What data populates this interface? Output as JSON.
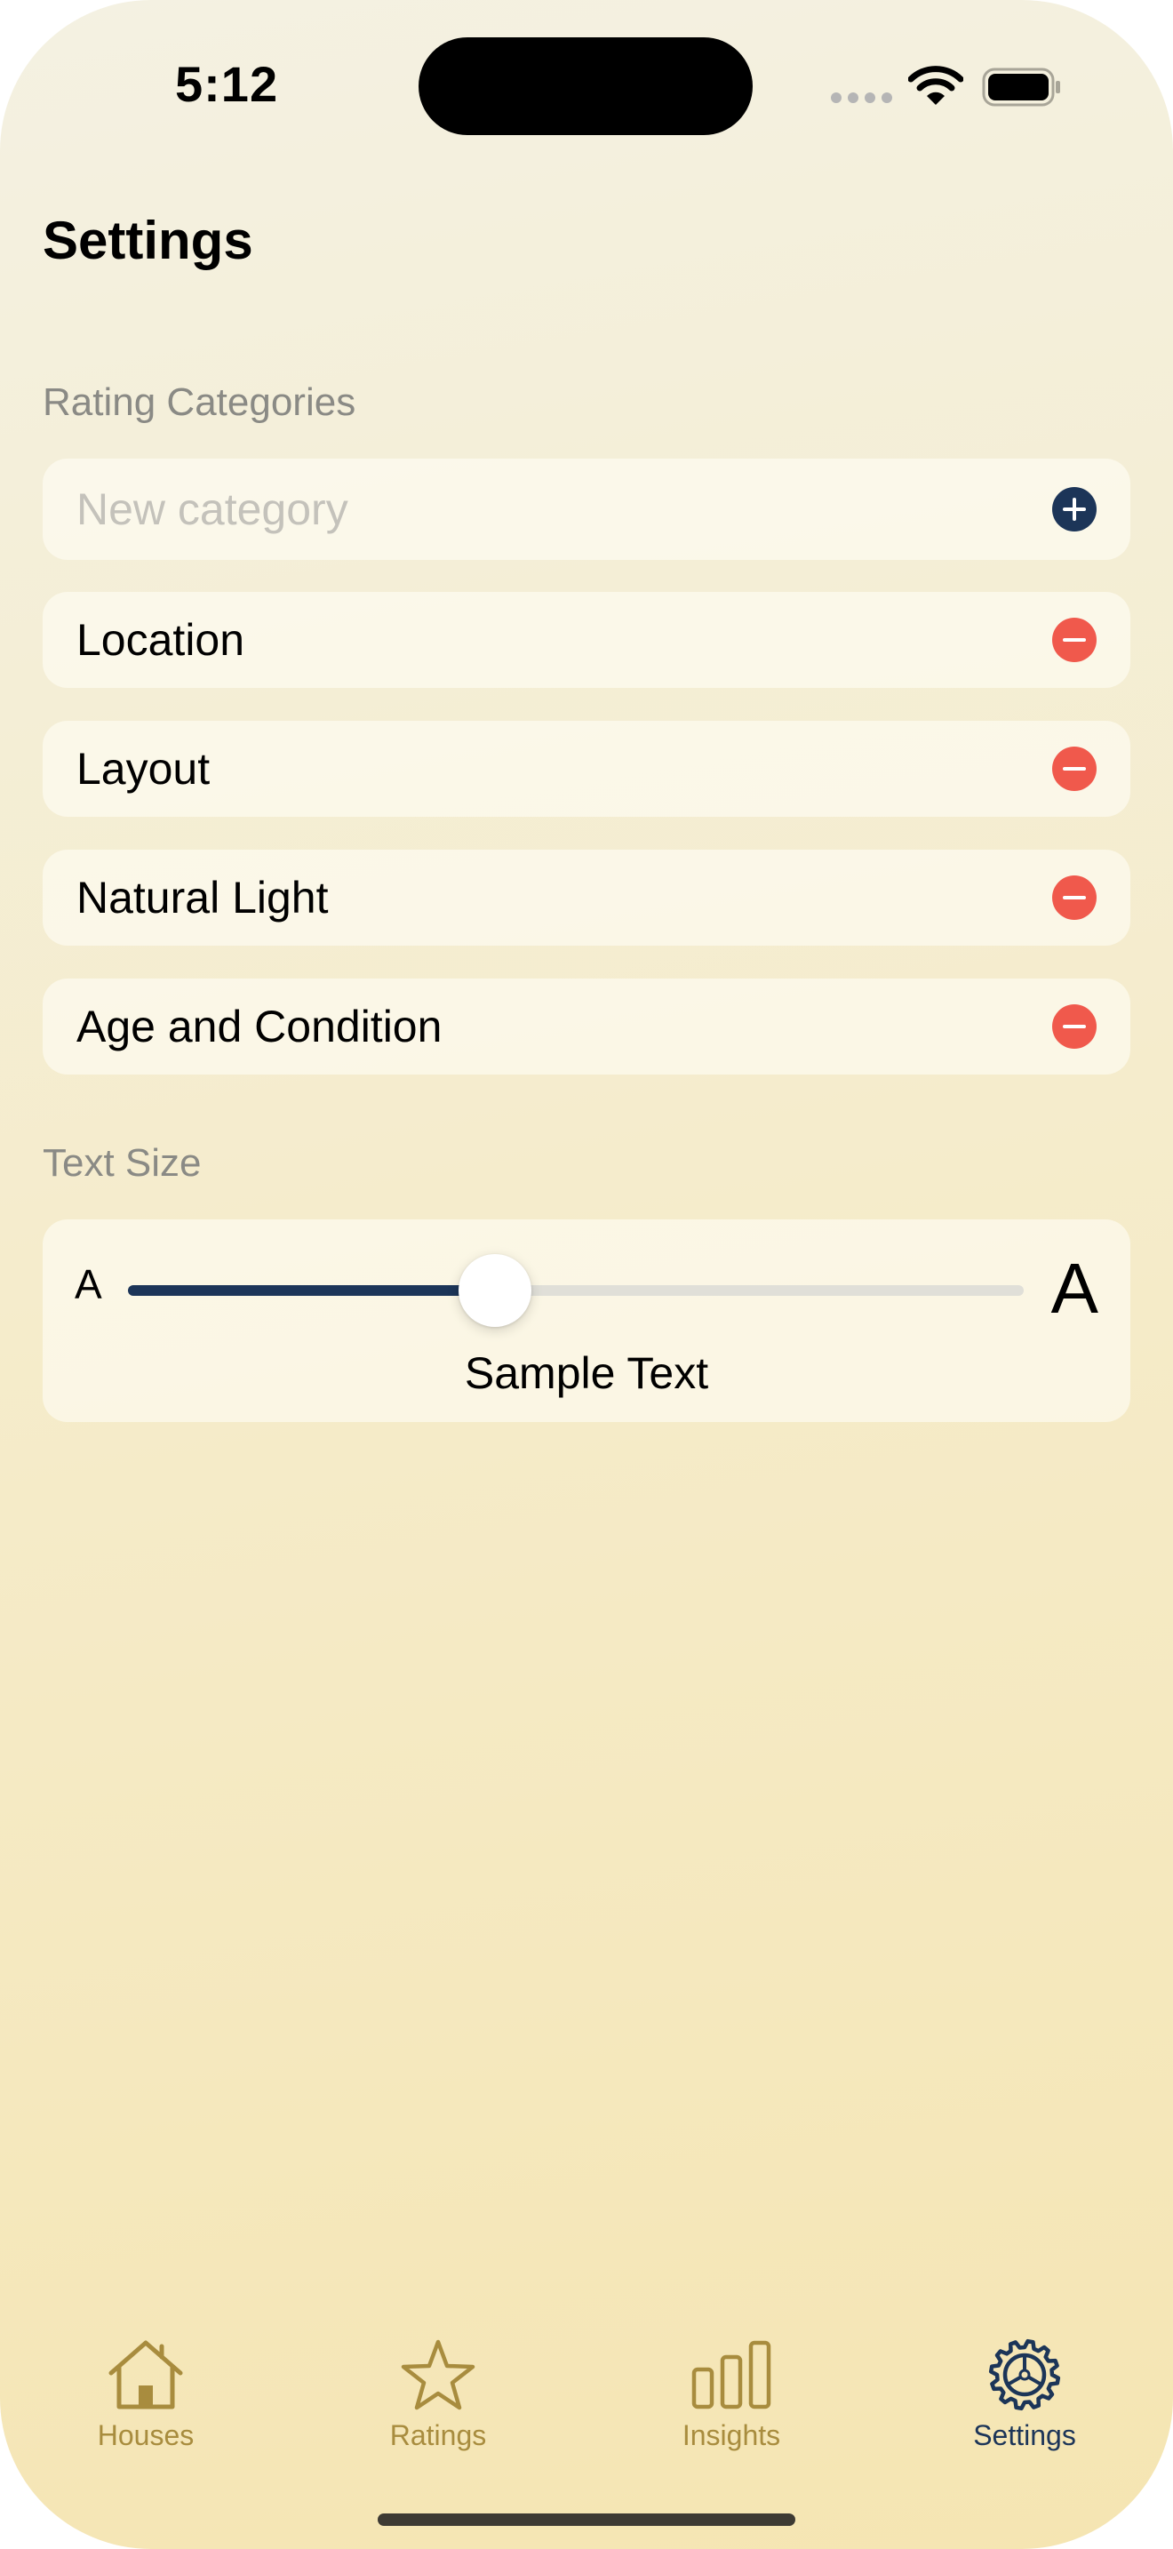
{
  "status_bar": {
    "time": "5:12"
  },
  "page": {
    "title": "Settings"
  },
  "rating_categories": {
    "header": "Rating Categories",
    "new_category_placeholder": "New category",
    "new_category_value": "",
    "items": [
      {
        "label": "Location"
      },
      {
        "label": "Layout"
      },
      {
        "label": "Natural Light"
      },
      {
        "label": "Age and Condition"
      }
    ]
  },
  "text_size": {
    "header": "Text Size",
    "small_label": "A",
    "large_label": "A",
    "slider_level": 0.41,
    "sample_text": "Sample Text"
  },
  "tab_bar": {
    "selected": "settings",
    "tabs": [
      {
        "id": "houses",
        "label": "Houses",
        "icon": "house-icon"
      },
      {
        "id": "ratings",
        "label": "Ratings",
        "icon": "star-icon"
      },
      {
        "id": "insights",
        "label": "Insights",
        "icon": "bar-chart-icon"
      },
      {
        "id": "settings",
        "label": "Settings",
        "icon": "gear-icon"
      }
    ]
  },
  "colors": {
    "accent": "#1c3558",
    "remove": "#f0594c",
    "tab_inactive": "#a88c3e",
    "section_header": "#8a8a85"
  }
}
